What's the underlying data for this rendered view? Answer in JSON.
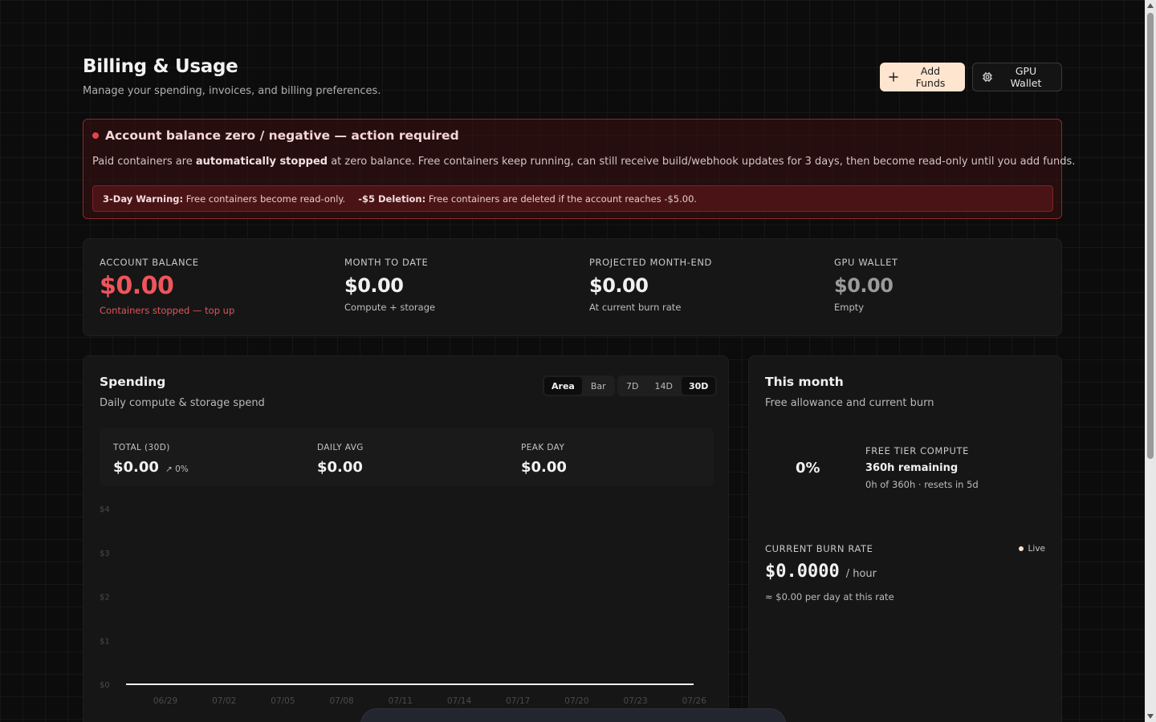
{
  "header": {
    "title": "Billing & Usage",
    "subtitle": "Manage your spending, invoices, and billing preferences.",
    "add_funds_label": "Add Funds",
    "gpu_wallet_label": "GPU Wallet"
  },
  "alert": {
    "title": "Account balance zero / negative — action required",
    "body_prefix": "Paid containers are ",
    "body_bold": "automatically stopped",
    "body_suffix": " at zero balance. Free containers keep running, can still receive build/webhook updates for 3 days, then become read-only until you add funds.",
    "warning1_bold": "3-Day Warning:",
    "warning1_text": " Free containers become read-only.",
    "warning2_bold": "-$5 Deletion:",
    "warning2_text": " Free containers are deleted if the account reaches -$5.00."
  },
  "stats": [
    {
      "label": "ACCOUNT BALANCE",
      "value": "$0.00",
      "sub": "Containers stopped — top up"
    },
    {
      "label": "MONTH TO DATE",
      "value": "$0.00",
      "sub": "Compute + storage"
    },
    {
      "label": "PROJECTED MONTH-END",
      "value": "$0.00",
      "sub": "At current burn rate"
    },
    {
      "label": "GPU WALLET",
      "value": "$0.00",
      "sub": "Empty"
    }
  ],
  "spending": {
    "title": "Spending",
    "subtitle": "Daily compute & storage spend",
    "chart_types": [
      "Area",
      "Bar"
    ],
    "active_chart_type": "Area",
    "ranges": [
      "7D",
      "14D",
      "30D"
    ],
    "active_range": "30D",
    "kpis": [
      {
        "label": "TOTAL (30D)",
        "value": "$0.00",
        "change": "0%"
      },
      {
        "label": "DAILY AVG",
        "value": "$0.00"
      },
      {
        "label": "PEAK DAY",
        "value": "$0.00"
      }
    ]
  },
  "chart_data": {
    "type": "area",
    "title": "",
    "xlabel": "",
    "ylabel": "",
    "y_ticks": [
      "$4",
      "$3",
      "$2",
      "$1",
      "$0"
    ],
    "ylim": [
      0,
      4
    ],
    "x_tick_labels": [
      "06/29",
      "07/02",
      "07/05",
      "07/08",
      "07/11",
      "07/14",
      "07/17",
      "07/20",
      "07/23",
      "07/26"
    ],
    "series": [
      {
        "values": [
          0,
          0,
          0,
          0,
          0,
          0,
          0,
          0,
          0,
          0,
          0,
          0,
          0,
          0,
          0,
          0,
          0,
          0,
          0,
          0,
          0,
          0,
          0,
          0,
          0,
          0,
          0,
          0,
          0,
          0
        ]
      }
    ],
    "grid": false,
    "colors": {
      "line": "#f2f2f2"
    }
  },
  "month": {
    "title": "This month",
    "subtitle": "Free allowance and current burn",
    "free_pct": "0%",
    "free_label": "FREE TIER COMPUTE",
    "free_remaining": "360h remaining",
    "free_detail": "0h of 360h · resets in 5d",
    "burn_label": "CURRENT BURN RATE",
    "live_label": "Live",
    "burn_value": "$0.0000",
    "burn_unit": "/ hour",
    "burn_detail": "≈ $0.00 per day at this rate"
  },
  "colors": {
    "accent": "#fde5cf",
    "danger": "#f0555c",
    "background": "#0c0c0c",
    "card": "#161616"
  }
}
